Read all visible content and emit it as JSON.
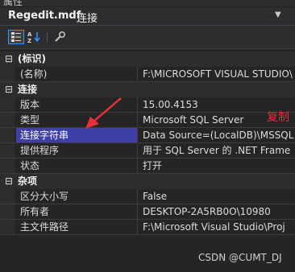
{
  "window": {
    "title": "属性"
  },
  "object_selector": {
    "name": "Regedit.mdf",
    "type": "连接"
  },
  "toolbar": {
    "buttons": [
      {
        "icon": "categorized-icon",
        "active": true
      },
      {
        "icon": "alphabetical-icon",
        "active": false
      },
      {
        "icon": "property-pages-icon",
        "active": false
      }
    ]
  },
  "groups": [
    {
      "label": "(标识)",
      "toggle": "⊟",
      "props": [
        {
          "key": "(名称)",
          "value": "F:\\MICROSOFT VISUAL STUDIO\\"
        }
      ]
    },
    {
      "label": "连接",
      "toggle": "⊟",
      "props": [
        {
          "key": "版本",
          "value": "15.00.4153"
        },
        {
          "key": "类型",
          "value": "Microsoft SQL Server"
        },
        {
          "key": "连接字符串",
          "value": "Data Source=(LocalDB)\\MSSQL",
          "selected": true
        },
        {
          "key": "提供程序",
          "value": "用于 SQL Server 的 .NET Frame"
        },
        {
          "key": "状态",
          "value": "打开"
        }
      ]
    },
    {
      "label": "杂项",
      "toggle": "⊟",
      "props": [
        {
          "key": "区分大小写",
          "value": "False"
        },
        {
          "key": "所有者",
          "value": "DESKTOP-2A5RB0O\\10980"
        },
        {
          "key": "主文件路径",
          "value": "F:\\Microsoft Visual Studio\\Proj"
        }
      ]
    }
  ],
  "annotation": {
    "text": "复制",
    "color": "#e8303a"
  },
  "watermark": "CSDN @CUMT_DJ",
  "colors": {
    "selection": "#3f3fa8",
    "background": "#252526",
    "header": "#2d2d30"
  }
}
